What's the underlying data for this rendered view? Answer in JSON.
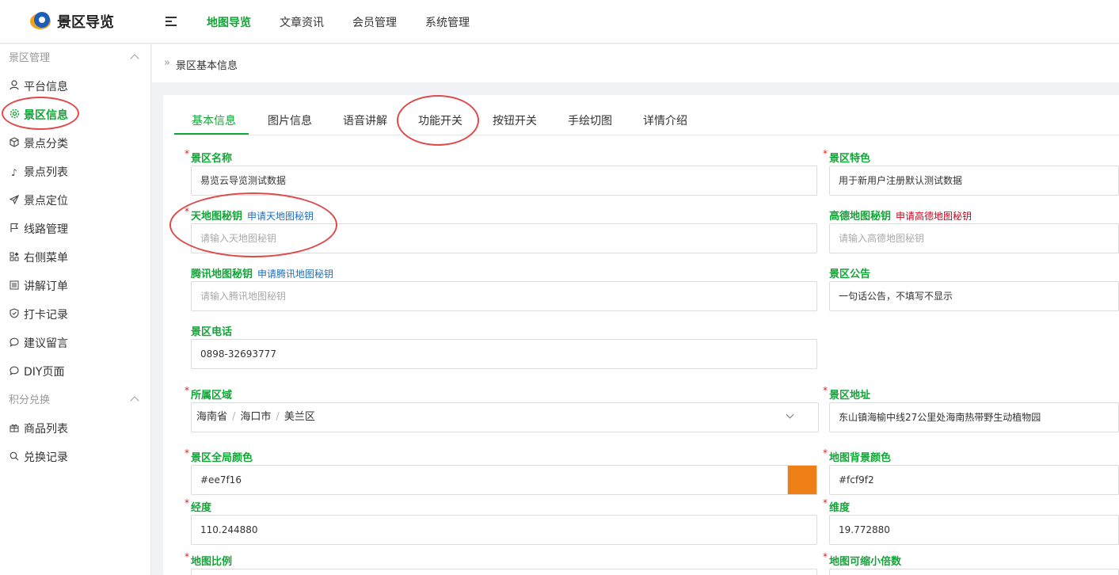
{
  "app": {
    "title": "景区导览"
  },
  "topnav": {
    "items": [
      {
        "label": "地图导览",
        "active": true
      },
      {
        "label": "文章资讯",
        "active": false
      },
      {
        "label": "会员管理",
        "active": false
      },
      {
        "label": "系统管理",
        "active": false
      }
    ]
  },
  "sidebar": {
    "groups": [
      {
        "title": "景区管理",
        "items": [
          {
            "label": "平台信息",
            "icon": "user-icon"
          },
          {
            "label": "景区信息",
            "icon": "gear-icon",
            "active": true
          },
          {
            "label": "景点分类",
            "icon": "cube-icon"
          },
          {
            "label": "景点列表",
            "icon": "music-note-icon"
          },
          {
            "label": "景点定位",
            "icon": "send-icon"
          },
          {
            "label": "线路管理",
            "icon": "flag-icon"
          },
          {
            "label": "右侧菜单",
            "icon": "apps-icon"
          },
          {
            "label": "讲解订单",
            "icon": "list-icon"
          },
          {
            "label": "打卡记录",
            "icon": "shield-check-icon"
          },
          {
            "label": "建议留言",
            "icon": "chat-icon"
          },
          {
            "label": "DIY页面",
            "icon": "chat-icon"
          }
        ]
      },
      {
        "title": "积分兑换",
        "items": [
          {
            "label": "商品列表",
            "icon": "gift-icon"
          },
          {
            "label": "兑换记录",
            "icon": "search-icon"
          }
        ]
      }
    ]
  },
  "breadcrumb": {
    "current": "景区基本信息"
  },
  "tabs": [
    "基本信息",
    "图片信息",
    "语音讲解",
    "功能开关",
    "按钮开关",
    "手绘切图",
    "详情介绍"
  ],
  "form": {
    "scenic_name": {
      "label": "景区名称",
      "value": "易览云导览测试数据"
    },
    "scenic_feature": {
      "label": "景区特色",
      "value": "用于新用户注册默认测试数据"
    },
    "tianditu_key": {
      "label": "天地图秘钥",
      "link": "申请天地图秘钥",
      "placeholder": "请输入天地图秘钥"
    },
    "amap_key": {
      "label": "高德地图秘钥",
      "link": "申请高德地图秘钥",
      "placeholder": "请输入高德地图秘钥"
    },
    "tencent_key": {
      "label": "腾讯地图秘钥",
      "link": "申请腾讯地图秘钥",
      "placeholder": "请输入腾讯地图秘钥"
    },
    "notice": {
      "label": "景区公告",
      "value": "一句话公告，不填写不显示"
    },
    "phone": {
      "label": "景区电话",
      "value": "0898-32693777"
    },
    "region": {
      "label": "所属区域",
      "province": "海南省",
      "city": "海口市",
      "district": "美兰区",
      "separator": "/"
    },
    "address": {
      "label": "景区地址",
      "value": "东山镇海榆中线27公里处海南热带野生动植物园"
    },
    "global_color": {
      "label": "景区全局颜色",
      "value": "#ee7f16",
      "swatch": "#ee7f16"
    },
    "map_bg_color": {
      "label": "地图背景颜色",
      "value": "#fcf9f2"
    },
    "longitude": {
      "label": "经度",
      "value": "110.244880"
    },
    "latitude": {
      "label": "维度",
      "value": "19.772880"
    },
    "map_scale": {
      "label": "地图比例"
    },
    "map_min_zoom": {
      "label": "地图可缩小倍数"
    },
    "required_mark": "*"
  },
  "colors": {
    "accent": "#13a538",
    "annotation": "#e04a4a",
    "link": "#1e6fbf",
    "link_red": "#d0021b"
  }
}
